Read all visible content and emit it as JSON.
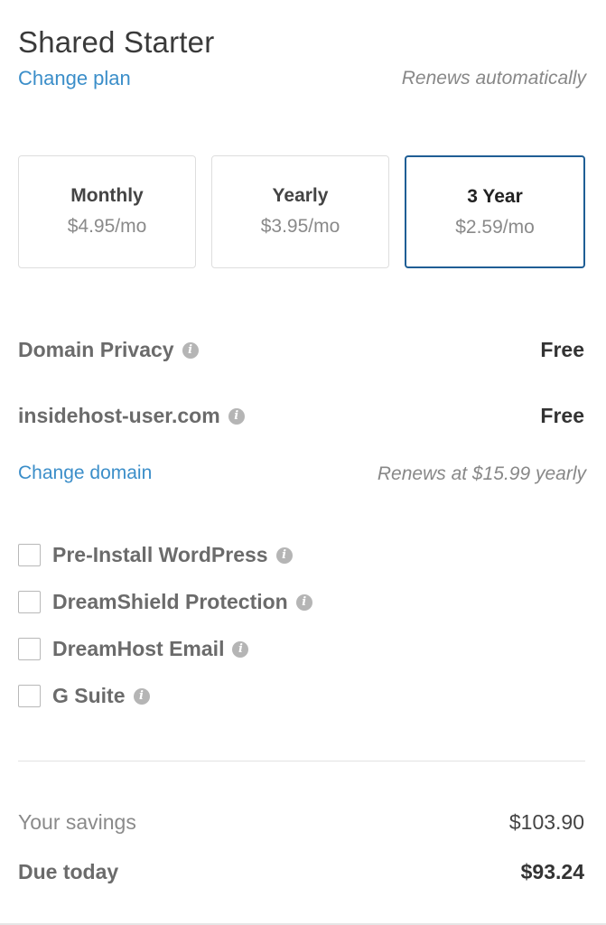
{
  "plan": {
    "title": "Shared Starter",
    "change_plan_label": "Change plan",
    "renews_note": "Renews automatically"
  },
  "terms": [
    {
      "name": "Monthly",
      "price": "$4.95/mo",
      "selected": false
    },
    {
      "name": "Yearly",
      "price": "$3.95/mo",
      "selected": false
    },
    {
      "name": "3 Year",
      "price": "$2.59/mo",
      "selected": true
    }
  ],
  "extras": {
    "domain_privacy": {
      "label": "Domain Privacy",
      "value": "Free"
    },
    "domain": {
      "label": "insidehost-user.com",
      "value": "Free"
    },
    "change_domain_label": "Change domain",
    "domain_renewal_note": "Renews at $15.99 yearly"
  },
  "addons": [
    {
      "label": "Pre-Install WordPress",
      "checked": false
    },
    {
      "label": "DreamShield Protection",
      "checked": false
    },
    {
      "label": "DreamHost Email",
      "checked": false
    },
    {
      "label": "G Suite",
      "checked": false
    }
  ],
  "summary": {
    "savings_label": "Your savings",
    "savings_value": "$103.90",
    "due_label": "Due today",
    "due_value": "$93.24"
  },
  "colors": {
    "link": "#3b8ec9",
    "selected_border": "#1f5e95",
    "muted_text": "#888888"
  },
  "icons": {
    "info": "info-icon"
  }
}
